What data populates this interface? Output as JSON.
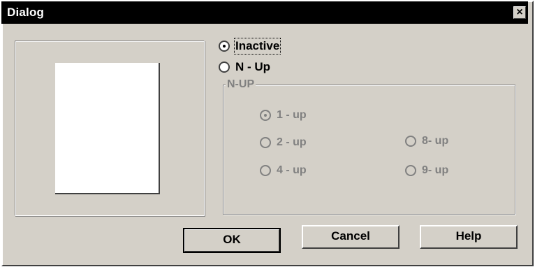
{
  "window": {
    "title": "Dialog"
  },
  "close_icon_glyph": "×",
  "mode": {
    "inactive_label": "Inactive",
    "nup_label": "N - Up",
    "selected": "Inactive"
  },
  "nup_group": {
    "label": "N-UP",
    "disabled": true,
    "options": [
      {
        "label": "1 - up",
        "checked": true
      },
      {
        "label": "2 - up",
        "checked": false
      },
      {
        "label": "4 - up",
        "checked": false
      },
      {
        "label": "8- up",
        "checked": false
      },
      {
        "label": "9- up",
        "checked": false
      }
    ]
  },
  "buttons": {
    "ok": "OK",
    "cancel": "Cancel",
    "help": "Help"
  },
  "colors": {
    "face": "#d4d0c8",
    "titlebar": "#000000",
    "disabled_text": "#808080"
  }
}
